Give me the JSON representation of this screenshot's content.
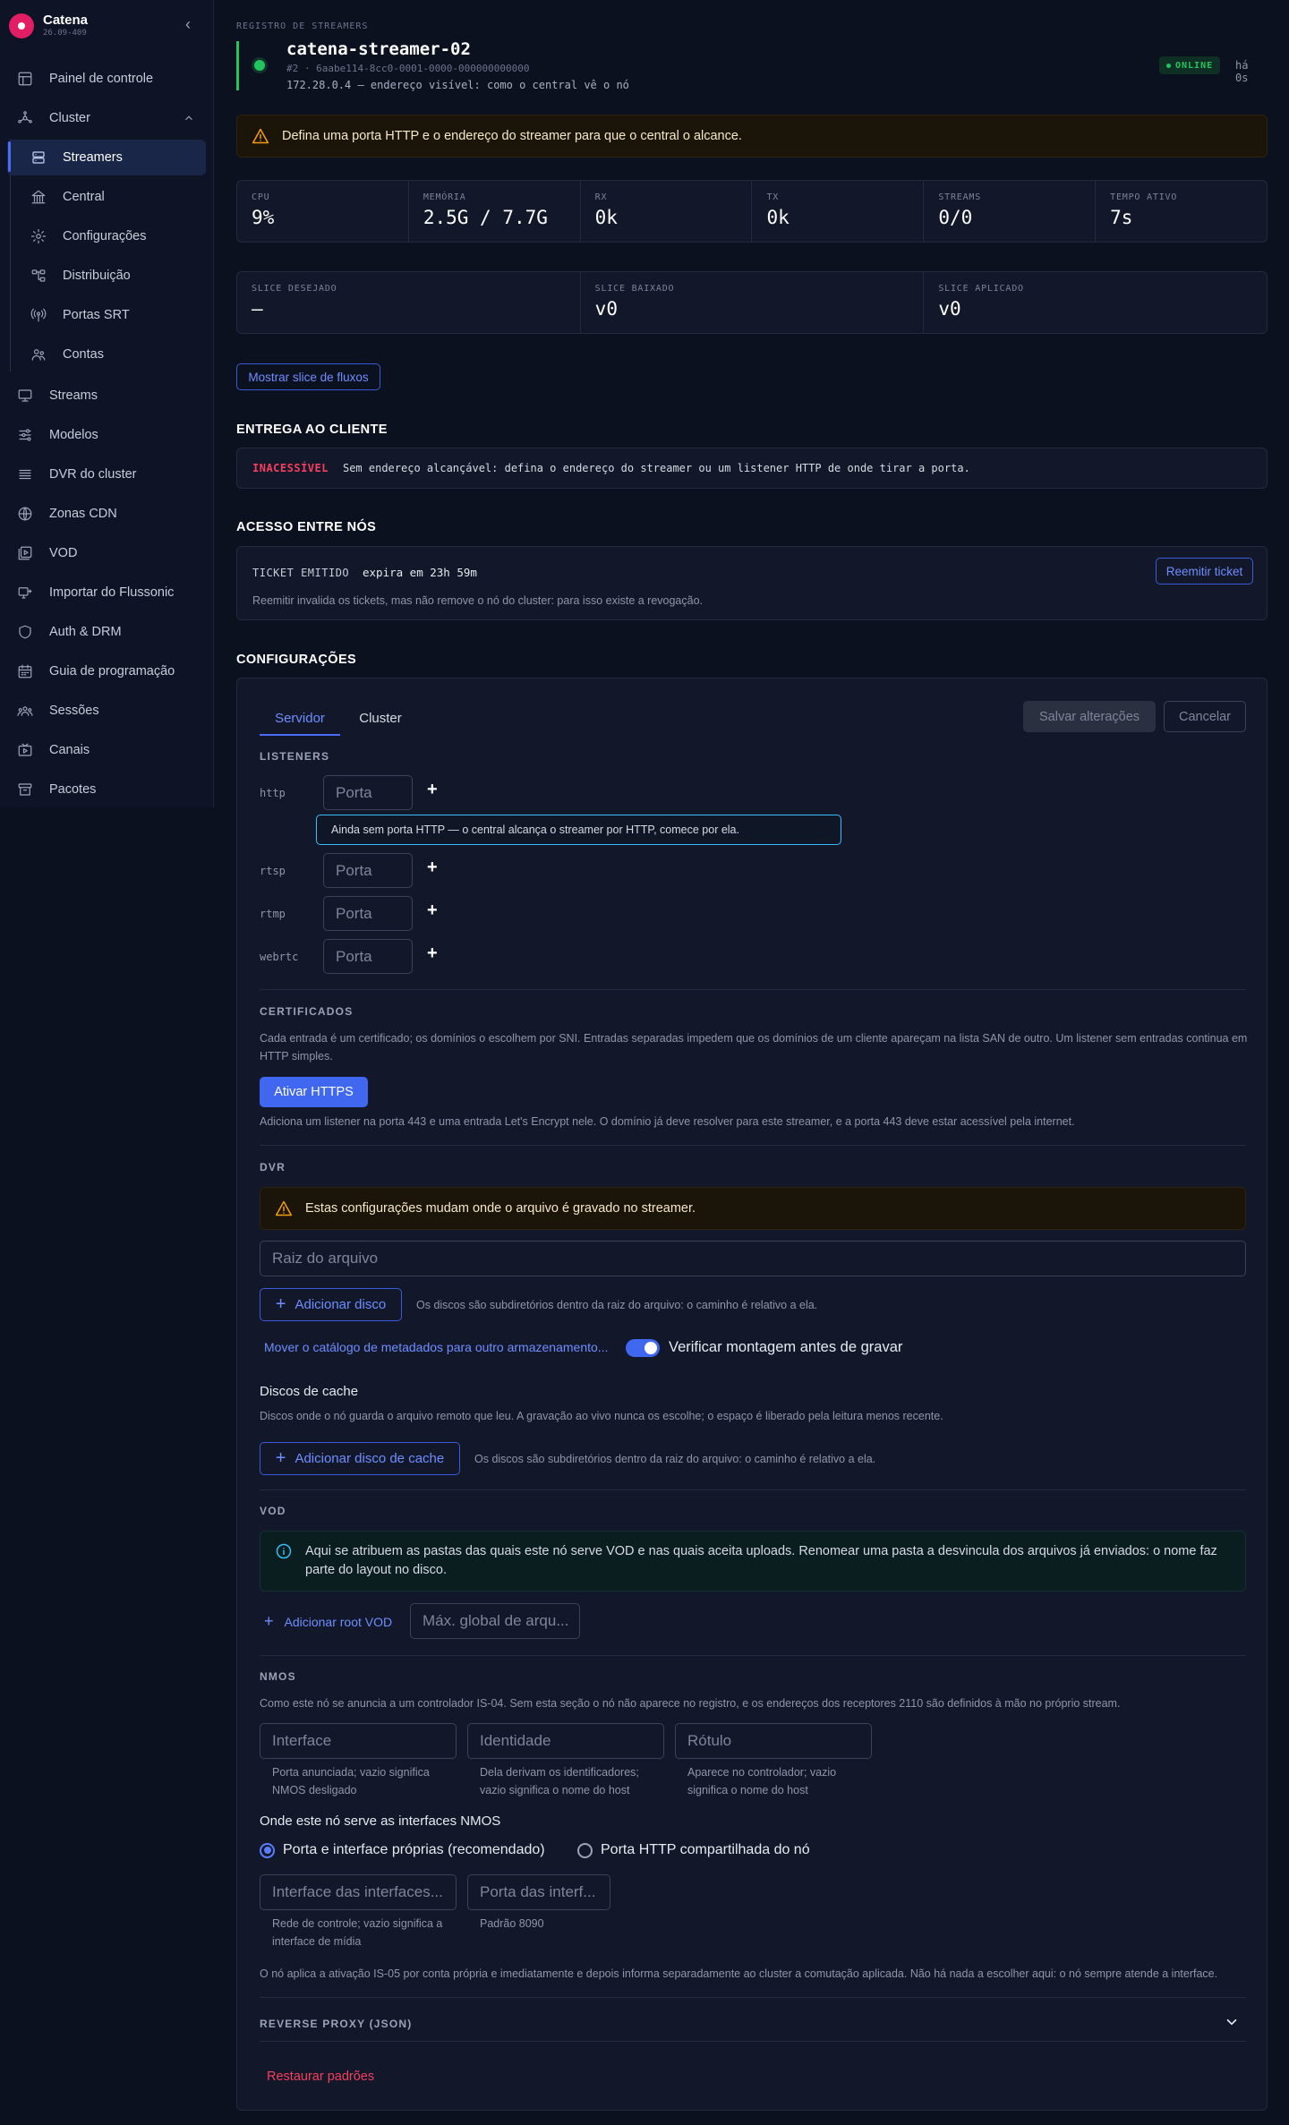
{
  "brand": {
    "name": "Catena",
    "version": "26.09-409"
  },
  "nav": {
    "dashboard": "Painel de controle",
    "cluster": "Cluster",
    "streamers": "Streamers",
    "central": "Central",
    "configuracoes": "Configurações",
    "distribuicao": "Distribuição",
    "portas_srt": "Portas SRT",
    "contas": "Contas",
    "streams": "Streams",
    "modelos": "Modelos",
    "dvr": "DVR do cluster",
    "cdn": "Zonas CDN",
    "vod": "VOD",
    "flussonic": "Importar do Flussonic",
    "auth": "Auth & DRM",
    "guia": "Guia de programação",
    "sessoes": "Sessões",
    "canais": "Canais",
    "pacotes": "Pacotes"
  },
  "header": {
    "eyebrow": "REGISTRO DE STREAMERS",
    "title": "catena-streamer-02",
    "id": "#2 · 6aabe114-8cc0-0001-0000-000000000000",
    "address": "172.28.0.4 — endereço visível: como o central vê o nó",
    "status": "ONLINE",
    "seen": "há 0s",
    "status_color": "#22c55e"
  },
  "warning_top": "Defina uma porta HTTP e o endereço do streamer para que o central o alcance.",
  "stats": [
    {
      "label": "CPU",
      "value": "9%"
    },
    {
      "label": "MEMÓRIA",
      "value": "2.5G / 7.7G"
    },
    {
      "label": "RX",
      "value": "0k"
    },
    {
      "label": "TX",
      "value": "0k"
    },
    {
      "label": "STREAMS",
      "value": "0/0"
    },
    {
      "label": "TEMPO ATIVO",
      "value": "7s"
    }
  ],
  "slices": [
    {
      "label": "SLICE DESEJADO",
      "value": "—"
    },
    {
      "label": "SLICE BAIXADO",
      "value": "v0"
    },
    {
      "label": "SLICE APLICADO",
      "value": "v0"
    }
  ],
  "show_slice_button": "Mostrar slice de fluxos",
  "delivery": {
    "title": "ENTREGA AO CLIENTE",
    "status": "INACESSÍVEL",
    "message": "Sem endereço alcançável: defina o endereço do streamer ou um listener HTTP de onde tirar a porta."
  },
  "access": {
    "title": "ACESSO ENTRE NÓS",
    "ticket_label": "TICKET EMITIDO",
    "ticket_expiry": "expira em 23h 59m",
    "reissue_button": "Reemitir ticket",
    "note": "Reemitir invalida os tickets, mas não remove o nó do cluster: para isso existe a revogação."
  },
  "config": {
    "title": "CONFIGURAÇÕES",
    "tabs": {
      "server": "Servidor",
      "cluster": "Cluster"
    },
    "save_button": "Salvar alterações",
    "cancel_button": "Cancelar",
    "listeners": {
      "title": "LISTENERS",
      "port_placeholder": "Porta",
      "protocols": {
        "http": "http",
        "rtsp": "rtsp",
        "rtmp": "rtmp",
        "webrtc": "webrtc"
      },
      "http_hint": "Ainda sem porta HTTP — o central alcança o streamer por HTTP, comece por ela."
    },
    "certs": {
      "title": "CERTIFICADOS",
      "desc": "Cada entrada é um certificado; os domínios o escolhem por SNI. Entradas separadas impedem que os domínios de um cliente apareçam na lista SAN de outro. Um listener sem entradas continua em HTTP simples.",
      "button": "Ativar HTTPS",
      "note": "Adiciona um listener na porta 443 e uma entrada Let's Encrypt nele. O domínio já deve resolver para este streamer, e a porta 443 deve estar acessível pela internet."
    },
    "dvr": {
      "title": "DVR",
      "warning": "Estas configurações mudam onde o arquivo é gravado no streamer.",
      "root_placeholder": "Raiz do arquivo",
      "add_disk": "Adicionar disco",
      "disk_note": "Os discos são subdiretórios dentro da raiz do arquivo: o caminho é relativo a ela.",
      "move_catalog": "Mover o catálogo de metadados para outro armazenamento...",
      "verify_mount": "Verificar montagem antes de gravar",
      "cache_title": "Discos de cache",
      "cache_desc": "Discos onde o nó guarda o arquivo remoto que leu. A gravação ao vivo nunca os escolhe; o espaço é liberado pela leitura menos recente.",
      "add_cache": "Adicionar disco de cache",
      "cache_note": "Os discos são subdiretórios dentro da raiz do arquivo: o caminho é relativo a ela."
    },
    "vod": {
      "title": "VOD",
      "info": "Aqui se atribuem as pastas das quais este nó serve VOD e nas quais aceita uploads. Renomear uma pasta a desvincula dos arquivos já enviados: o nome faz parte do layout no disco.",
      "add_root": "Adicionar root VOD",
      "max_placeholder": "Máx. global de arqu..."
    },
    "nmos": {
      "title": "NMOS",
      "desc": "Como este nó se anuncia a um controlador IS-04. Sem esta seção o nó não aparece no registro, e os endereços dos receptores 2110 são definidos à mão no próprio stream.",
      "interface_ph": "Interface",
      "identity_ph": "Identidade",
      "label_ph": "Rótulo",
      "interface_help": "Porta anunciada; vazio significa NMOS desligado",
      "identity_help": "Dela derivam os identificadores; vazio significa o nome do host",
      "label_help": "Aparece no controlador; vazio significa o nome do host",
      "serve_title": "Onde este nó serve as interfaces NMOS",
      "option_own": "Porta e interface próprias (recomendado)",
      "option_shared": "Porta HTTP compartilhada do nó",
      "iface_ph": "Interface das interfaces...",
      "port_ph": "Porta das interf...",
      "iface_help": "Rede de controle; vazio significa a interface de mídia",
      "port_help": "Padrão 8090",
      "footer": "O nó aplica a ativação IS-05 por conta própria e imediatamente e depois informa separadamente ao cluster a comutação aplicada. Não há nada a escolher aqui: o nó sempre atende a interface."
    },
    "reverse_proxy": "REVERSE PROXY (JSON)",
    "restore": "Restaurar padrões"
  }
}
